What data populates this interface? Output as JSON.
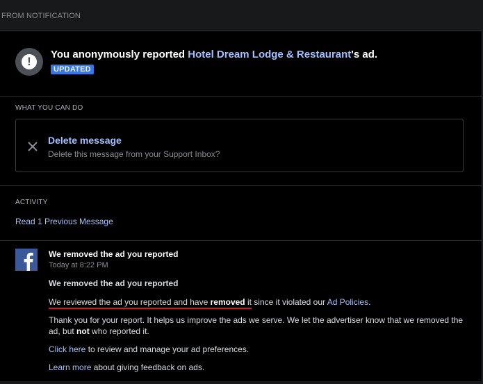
{
  "from_label": "FROM NOTIFICATION",
  "header": {
    "text_before": "You anonymously reported ",
    "page_name": "Hotel Dream Lodge & Restaurant",
    "text_after": "'s ad.",
    "badge": "UPDATED"
  },
  "actions": {
    "section_label": "WHAT YOU CAN DO",
    "delete_title": "Delete message",
    "delete_desc": "Delete this message from your Support Inbox?"
  },
  "activity": {
    "section_label": "ACTIVITY",
    "link": "Read 1 Previous Message"
  },
  "message": {
    "from": "We removed the ad you reported",
    "time": "Today at 8:22 PM",
    "subject": "We removed the ad you reported",
    "p1_part1": "We reviewed the ad you reported and have ",
    "p1_bold": "removed",
    "p1_part2": " it",
    "p1_part3": " since it violated our ",
    "p1_link": "Ad Policies",
    "p1_end": ".",
    "p2_part1": "Thank you for your report. It helps us improve the ads we serve. We let the advertiser know that we removed the ad, but ",
    "p2_bold": "not",
    "p2_part2": " who reported it.",
    "p3_link": "Click here",
    "p3_text": " to review and manage your ad preferences.",
    "p4_link": "Learn more",
    "p4_text": " about giving feedback on ads."
  },
  "colors": {
    "accent_link": "#a4c1ff",
    "badge_bg": "#3578e5",
    "facebook_blue": "#3b5998",
    "highlight_underline": "#d11a1a"
  }
}
